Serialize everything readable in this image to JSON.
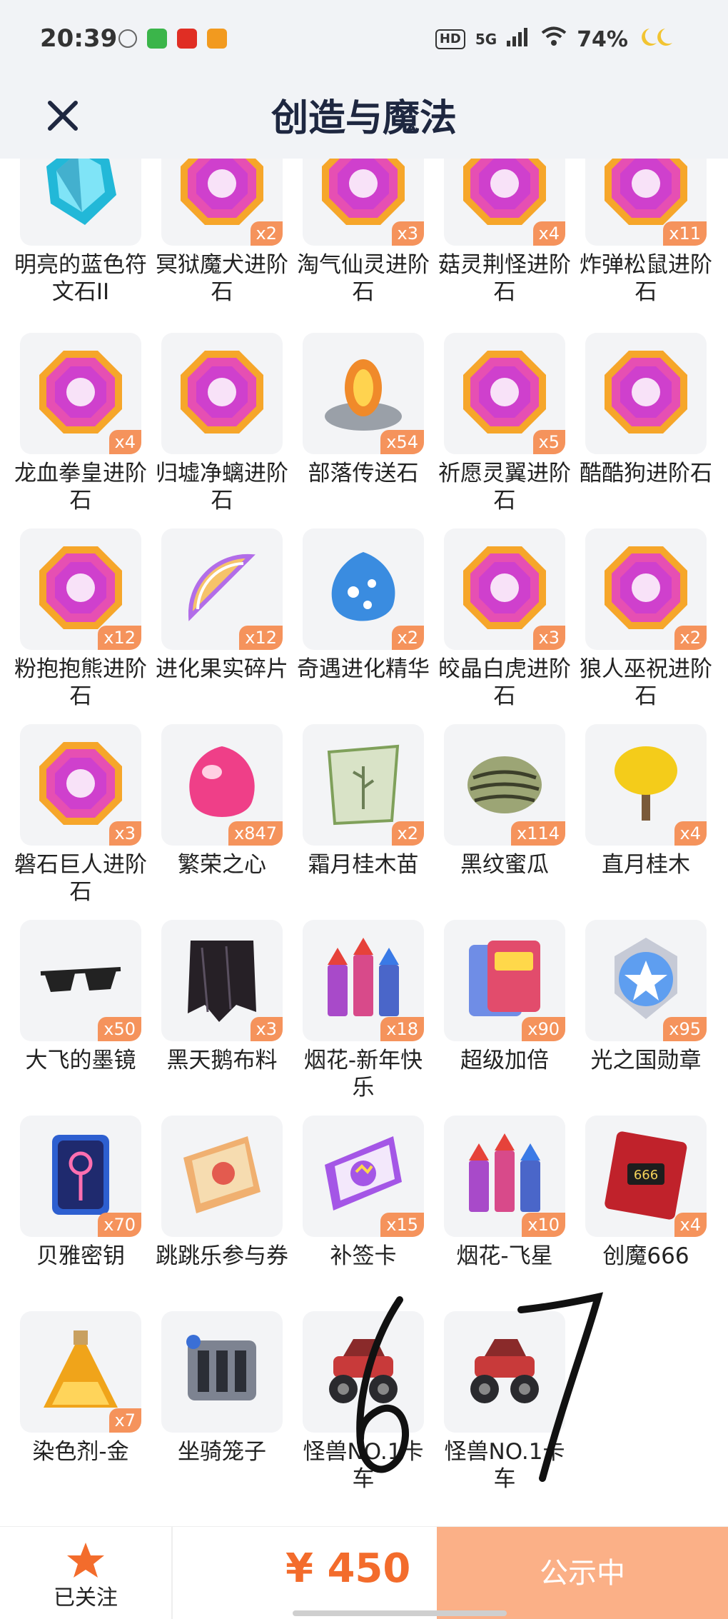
{
  "status_bar": {
    "time": "20:39",
    "battery": "74%",
    "network": "5G",
    "hd": "HD"
  },
  "nav": {
    "title": "创造与魔法"
  },
  "items": [
    {
      "name": "明亮的蓝色符文石II",
      "count": "",
      "icon": "blue-rune-stone-icon",
      "color": "#22b8d8"
    },
    {
      "name": "冥狱魔犬进阶石",
      "count": "x2",
      "icon": "pink-gem-icon",
      "color": "#e64fb3"
    },
    {
      "name": "淘气仙灵进阶石",
      "count": "x3",
      "icon": "pink-gem-icon",
      "color": "#e64fb3"
    },
    {
      "name": "菇灵荆怪进阶石",
      "count": "x4",
      "icon": "pink-gem-icon",
      "color": "#e64fb3"
    },
    {
      "name": "炸弹松鼠进阶石",
      "count": "x11",
      "icon": "pink-gem-icon",
      "color": "#e64fb3"
    },
    {
      "name": "龙血拳皇进阶石",
      "count": "x4",
      "icon": "pink-gem-icon",
      "color": "#e64fb3"
    },
    {
      "name": "归墟净螭进阶石",
      "count": "",
      "icon": "pink-gem-icon",
      "color": "#e64fb3"
    },
    {
      "name": "部落传送石",
      "count": "x54",
      "icon": "teleport-stone-icon",
      "color": "#f08a2a"
    },
    {
      "name": "祈愿灵翼进阶石",
      "count": "x5",
      "icon": "pink-gem-icon",
      "color": "#e64fb3"
    },
    {
      "name": "酷酷狗进阶石",
      "count": "",
      "icon": "pink-gem-icon",
      "color": "#e64fb3"
    },
    {
      "name": "粉抱抱熊进阶石",
      "count": "x12",
      "icon": "pink-gem-icon",
      "color": "#e64fb3"
    },
    {
      "name": "进化果实碎片",
      "count": "x12",
      "icon": "fruit-fragment-icon",
      "color": "#f6c36a"
    },
    {
      "name": "奇遇进化精华",
      "count": "x2",
      "icon": "blue-essence-icon",
      "color": "#3a8ce0"
    },
    {
      "name": "皎晶白虎进阶石",
      "count": "x3",
      "icon": "pink-gem-icon",
      "color": "#e64fb3"
    },
    {
      "name": "狼人巫祝进阶石",
      "count": "x2",
      "icon": "pink-gem-icon",
      "color": "#e64fb3"
    },
    {
      "name": "磐石巨人进阶石",
      "count": "x3",
      "icon": "pink-gem-icon",
      "color": "#e64fb3"
    },
    {
      "name": "繁荣之心",
      "count": "x847",
      "icon": "pink-heart-gem-icon",
      "color": "#ef3f88"
    },
    {
      "name": "霜月桂木苗",
      "count": "x2",
      "icon": "seed-packet-icon",
      "color": "#d9e3c7"
    },
    {
      "name": "黑纹蜜瓜",
      "count": "x114",
      "icon": "melon-icon",
      "color": "#9ca575"
    },
    {
      "name": "直月桂木",
      "count": "x4",
      "icon": "tree-icon",
      "color": "#f4cc1a"
    },
    {
      "name": "大飞的墨镜",
      "count": "x50",
      "icon": "sunglasses-icon",
      "color": "#222222"
    },
    {
      "name": "黑天鹅布料",
      "count": "x3",
      "icon": "black-cloth-icon",
      "color": "#262026"
    },
    {
      "name": "烟花-新年快乐",
      "count": "x18",
      "icon": "fireworks-icon",
      "color": "#a84ac9"
    },
    {
      "name": "超级加倍",
      "count": "x90",
      "icon": "card-icon",
      "color": "#e24c6c"
    },
    {
      "name": "光之国勋章",
      "count": "x95",
      "icon": "medal-icon",
      "color": "#5e9ef0"
    },
    {
      "name": "贝雅密钥",
      "count": "x70",
      "icon": "key-card-icon",
      "color": "#2d5fd0"
    },
    {
      "name": "跳跳乐参与券",
      "count": "",
      "icon": "ticket-icon",
      "color": "#f0b070"
    },
    {
      "name": "补签卡",
      "count": "x15",
      "icon": "sign-card-icon",
      "color": "#a456e6"
    },
    {
      "name": "烟花-飞星",
      "count": "x10",
      "icon": "fireworks-icon",
      "color": "#a84ac9"
    },
    {
      "name": "创魔666",
      "count": "x4",
      "icon": "red-card-666-icon",
      "color": "#c0222b"
    },
    {
      "name": "染色剂-金",
      "count": "x7",
      "icon": "gold-potion-icon",
      "color": "#f0a41a"
    },
    {
      "name": "坐骑笼子",
      "count": "",
      "icon": "mount-cage-icon",
      "color": "#7d8391"
    },
    {
      "name": "怪兽NO.1卡车",
      "count": "",
      "icon": "monster-truck-icon",
      "color": "#c83a3a"
    },
    {
      "name": "怪兽NO.1卡车",
      "count": "",
      "icon": "monster-truck-icon",
      "color": "#c83a3a"
    }
  ],
  "bottom": {
    "follow_label": "已关注",
    "price": "¥ 450",
    "status_label": "公示中"
  }
}
